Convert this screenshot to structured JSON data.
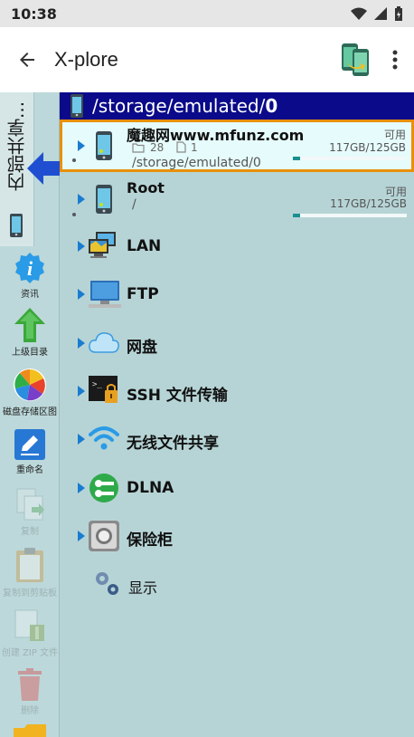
{
  "status": {
    "time": "10:38"
  },
  "appbar": {
    "title": "X-plore"
  },
  "sidebar": {
    "vertical_tab_label": "内部共享...",
    "tools": [
      {
        "label": "资讯",
        "enabled": true
      },
      {
        "label": "上级目录",
        "enabled": true
      },
      {
        "label": "磁盘存储区图",
        "enabled": true
      },
      {
        "label": "重命名",
        "enabled": true
      },
      {
        "label": "复制",
        "enabled": false
      },
      {
        "label": "复制到剪贴板",
        "enabled": false
      },
      {
        "label": "创建 ZIP 文件",
        "enabled": false
      },
      {
        "label": "删除",
        "enabled": false
      }
    ]
  },
  "path_bar": {
    "prefix": "/storage/emulated/",
    "last": "0"
  },
  "volumes": [
    {
      "name": "魔趣网www.mfunz.com",
      "folder_count": "28",
      "file_count": "1",
      "path": "/storage/emulated/0",
      "free_label": "可用",
      "size": "117GB/125GB",
      "used_fraction": 0.064,
      "selected": true
    },
    {
      "name": "Root",
      "path": "/",
      "free_label": "可用",
      "size": "117GB/125GB",
      "used_fraction": 0.064,
      "selected": false
    }
  ],
  "network_items": [
    {
      "label": "LAN",
      "icon": "lan-icon"
    },
    {
      "label": "FTP",
      "icon": "ftp-icon"
    },
    {
      "label": "网盘",
      "icon": "cloud-icon"
    },
    {
      "label": "SSH 文件传输",
      "icon": "ssh-icon"
    },
    {
      "label": "无线文件共享",
      "icon": "wifi-icon"
    },
    {
      "label": "DLNA",
      "icon": "dlna-icon"
    },
    {
      "label": "保险柜",
      "icon": "vault-icon"
    },
    {
      "label": "显示",
      "icon": "display-icon"
    }
  ],
  "colors": {
    "path_bar": "#0a0a8a",
    "panel_bg": "#b6d4d6",
    "selection_border": "#e8900a",
    "usage_fill": "#1a8f8f",
    "accent_blue": "#1b8fd8"
  }
}
